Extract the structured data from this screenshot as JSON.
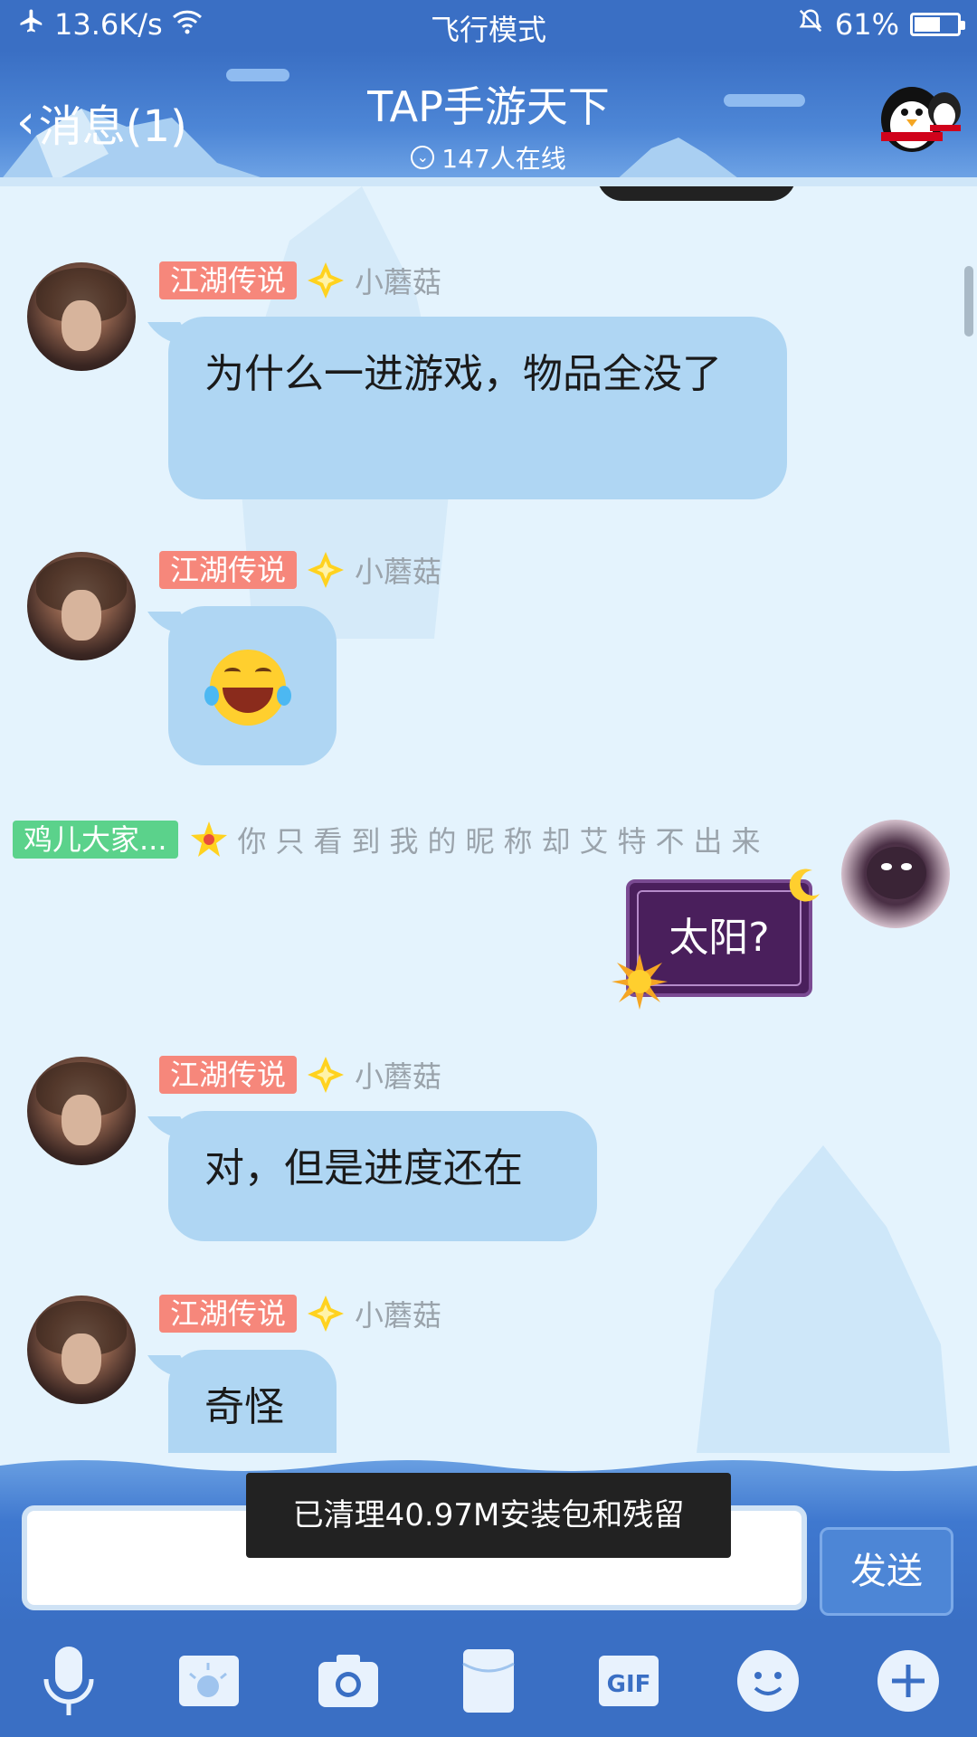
{
  "status_bar": {
    "network_speed": "13.6K/s",
    "mode": "飞行模式",
    "battery_percent": "61%",
    "battery_level": 0.61
  },
  "header": {
    "back_label": "消息(1)",
    "title": "TAP手游天下",
    "online_count": "147人在线"
  },
  "messages": [
    {
      "tag": "江湖传说",
      "name": "小蘑菇",
      "text": "为什么一进游戏，物品全没了"
    },
    {
      "tag": "江湖传说",
      "name": "小蘑菇",
      "emoji": "laughing-tears-emoji"
    },
    {
      "tag": "鸡儿大家...",
      "name": "你只看到我的昵称却艾特不出来",
      "text": "太阳?"
    },
    {
      "tag": "江湖传说",
      "name": "小蘑菇",
      "text": "对，但是进度还在"
    },
    {
      "tag": "江湖传说",
      "name": "小蘑菇",
      "text": "奇怪"
    }
  ],
  "input": {
    "placeholder": "",
    "send_label": "发送"
  },
  "toast": "已清理40.97M安装包和残留",
  "toolbar": [
    "mic-icon",
    "image-icon",
    "camera-icon",
    "red-packet-icon",
    "gif-icon",
    "emoji-icon",
    "plus-icon"
  ],
  "colors": {
    "header_blue": "#3a6fc4",
    "bubble_blue": "#afd6f3",
    "tag_red": "#f6877b",
    "tag_green": "#5bd28b"
  }
}
